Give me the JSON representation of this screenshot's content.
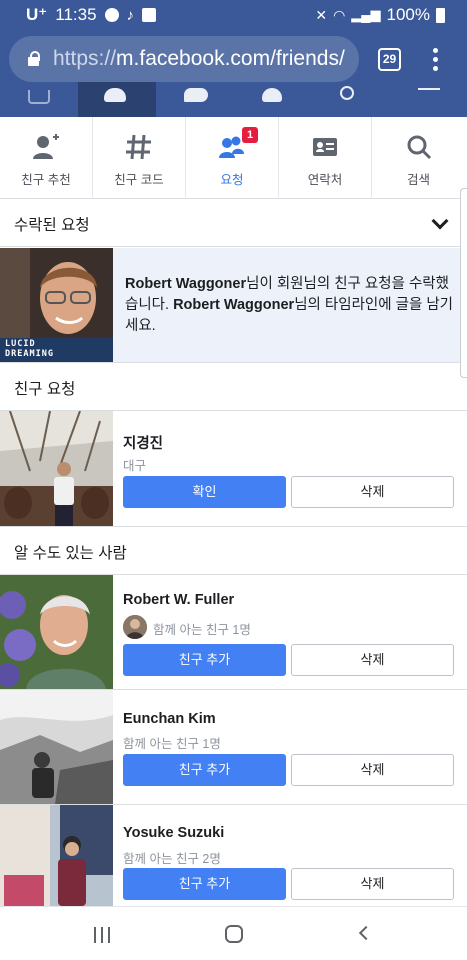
{
  "status_bar": {
    "carrier": "U⁺",
    "time": "11:35",
    "battery": "100%"
  },
  "browser": {
    "url_proto": "https://",
    "url_rest": "m.facebook.com/friends/",
    "tab_count": "29"
  },
  "subnav": {
    "tabs": [
      {
        "label": "친구 추천",
        "icon": "person-plus-icon"
      },
      {
        "label": "친구 코드",
        "icon": "hash-icon"
      },
      {
        "label": "요청",
        "icon": "friend-requests-icon",
        "badge": "1",
        "active": true
      },
      {
        "label": "연락처",
        "icon": "contact-card-icon"
      },
      {
        "label": "검색",
        "icon": "search-icon"
      }
    ]
  },
  "accepted": {
    "header": "수락된 요청",
    "name": "Robert Waggoner",
    "msg_1": "님이 회원님의 친구 요청을 수락했",
    "msg_2": "습니다. ",
    "msg_3": "님의 타임라인에 글을 남기",
    "msg_4": "세요.",
    "photo_caption_1": "LUCID",
    "photo_caption_2": "DREAMING"
  },
  "requests": {
    "header": "친구 요청",
    "items": [
      {
        "name": "지경진",
        "sub": "대구",
        "confirm": "확인",
        "delete": "삭제"
      }
    ]
  },
  "pymk": {
    "header": "알 수도 있는 사람",
    "items": [
      {
        "name": "Robert W. Fuller",
        "mutual": "함께 아는 친구 1명",
        "add": "친구 추가",
        "delete": "삭제"
      },
      {
        "name": "Eunchan Kim",
        "mutual": "함께 아는 친구 1명",
        "add": "친구 추가",
        "delete": "삭제"
      },
      {
        "name": "Yosuke Suzuki",
        "mutual": "함께 아는 친구 2명",
        "add": "친구 추가",
        "delete": "삭제"
      }
    ]
  },
  "colors": {
    "facebook_blue": "#3b5998",
    "button_blue": "#4280f4",
    "active_tab": "#3578e5",
    "badge_red": "#e41e3f"
  }
}
